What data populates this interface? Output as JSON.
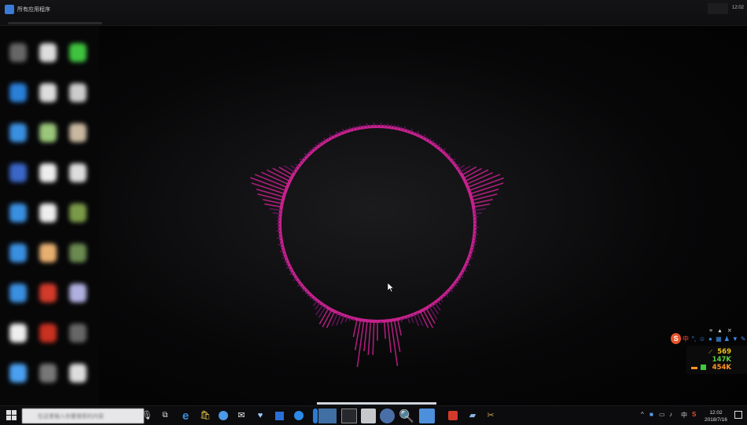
{
  "window": {
    "title": "所有应用程序",
    "clock": "12:02"
  },
  "taskbar": {
    "search_placeholder": "在这里输入你要搜索的内容",
    "clock_time": "12:02",
    "clock_date": "2018/7/16",
    "ime_lang": "中"
  },
  "ime_bar": {
    "logo": "S",
    "mode": "中",
    "punct": "°,",
    "emoji": "☺",
    "mic": "🎤",
    "keyboard": "⌨",
    "user": "👤",
    "shirt": "👕",
    "tools": "⚒"
  },
  "netmon": {
    "upload": "569",
    "download": "147K",
    "total": "454K"
  },
  "colors": {
    "visualizer": "#c6218c",
    "visualizer_dark": "#6b1562",
    "accent": "#3b7bd8"
  },
  "icons": {
    "start": "windows-icon",
    "taskview": "task-view-icon",
    "edge": "edge-icon",
    "store": "store-icon",
    "mail": "mail-icon"
  }
}
